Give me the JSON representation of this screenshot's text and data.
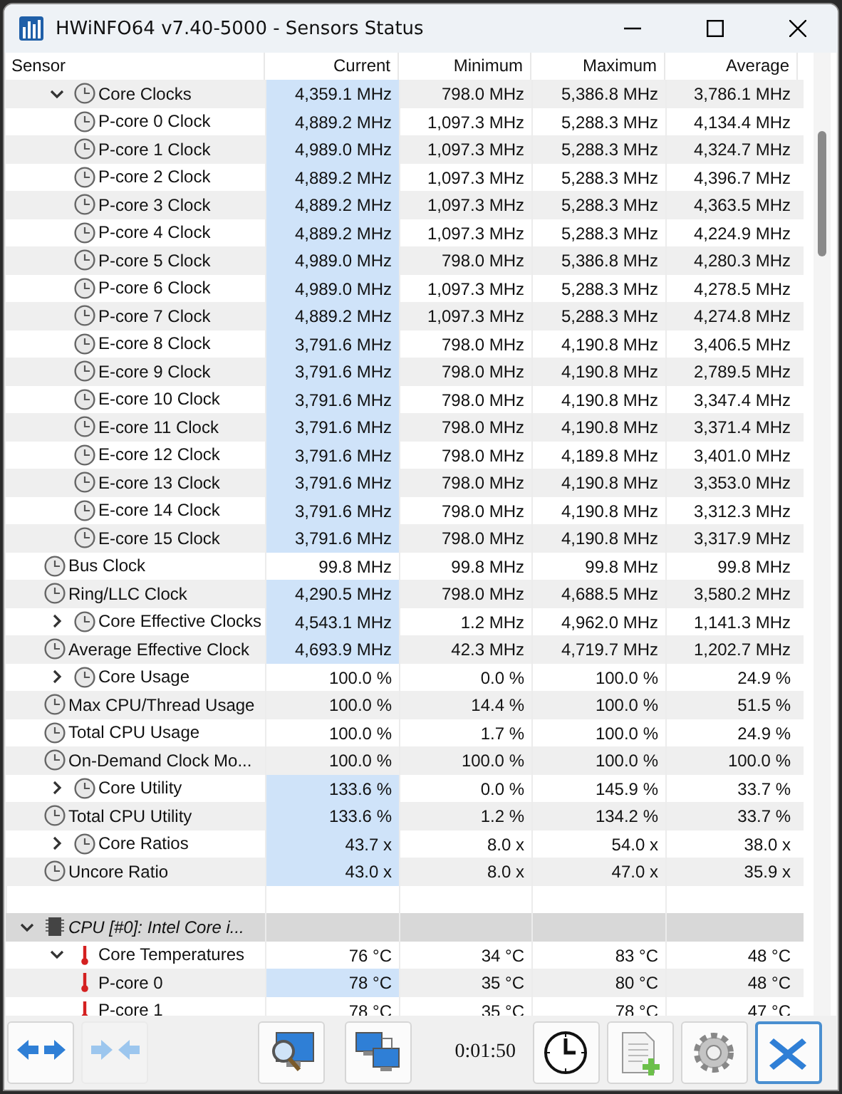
{
  "window": {
    "title": "HWiNFO64 v7.40-5000 - Sensors Status"
  },
  "columns": [
    "Sensor",
    "Current",
    "Minimum",
    "Maximum",
    "Average"
  ],
  "rows": [
    {
      "kind": "clock",
      "label": "Core Clocks",
      "current": "4,359.1 MHz",
      "minimum": "798.0 MHz",
      "maximum": "5,386.8 MHz",
      "average": "3,786.1 MHz",
      "highlighted": true,
      "expanded": true,
      "children": [
        {
          "kind": "clock",
          "label": "P-core 0 Clock",
          "current": "4,889.2 MHz",
          "minimum": "1,097.3 MHz",
          "maximum": "5,288.3 MHz",
          "average": "4,134.4 MHz",
          "highlighted": true
        },
        {
          "kind": "clock",
          "label": "P-core 1 Clock",
          "current": "4,989.0 MHz",
          "minimum": "1,097.3 MHz",
          "maximum": "5,288.3 MHz",
          "average": "4,324.7 MHz",
          "highlighted": true
        },
        {
          "kind": "clock",
          "label": "P-core 2 Clock",
          "current": "4,889.2 MHz",
          "minimum": "1,097.3 MHz",
          "maximum": "5,288.3 MHz",
          "average": "4,396.7 MHz",
          "highlighted": true
        },
        {
          "kind": "clock",
          "label": "P-core 3 Clock",
          "current": "4,889.2 MHz",
          "minimum": "1,097.3 MHz",
          "maximum": "5,288.3 MHz",
          "average": "4,363.5 MHz",
          "highlighted": true
        },
        {
          "kind": "clock",
          "label": "P-core 4 Clock",
          "current": "4,889.2 MHz",
          "minimum": "1,097.3 MHz",
          "maximum": "5,288.3 MHz",
          "average": "4,224.9 MHz",
          "highlighted": true
        },
        {
          "kind": "clock",
          "label": "P-core 5 Clock",
          "current": "4,989.0 MHz",
          "minimum": "798.0 MHz",
          "maximum": "5,386.8 MHz",
          "average": "4,280.3 MHz",
          "highlighted": true
        },
        {
          "kind": "clock",
          "label": "P-core 6 Clock",
          "current": "4,989.0 MHz",
          "minimum": "1,097.3 MHz",
          "maximum": "5,288.3 MHz",
          "average": "4,278.5 MHz",
          "highlighted": true
        },
        {
          "kind": "clock",
          "label": "P-core 7 Clock",
          "current": "4,889.2 MHz",
          "minimum": "1,097.3 MHz",
          "maximum": "5,288.3 MHz",
          "average": "4,274.8 MHz",
          "highlighted": true
        },
        {
          "kind": "clock",
          "label": "E-core 8 Clock",
          "current": "3,791.6 MHz",
          "minimum": "798.0 MHz",
          "maximum": "4,190.8 MHz",
          "average": "3,406.5 MHz",
          "highlighted": true
        },
        {
          "kind": "clock",
          "label": "E-core 9 Clock",
          "current": "3,791.6 MHz",
          "minimum": "798.0 MHz",
          "maximum": "4,190.8 MHz",
          "average": "2,789.5 MHz",
          "highlighted": true
        },
        {
          "kind": "clock",
          "label": "E-core 10 Clock",
          "current": "3,791.6 MHz",
          "minimum": "798.0 MHz",
          "maximum": "4,190.8 MHz",
          "average": "3,347.4 MHz",
          "highlighted": true
        },
        {
          "kind": "clock",
          "label": "E-core 11 Clock",
          "current": "3,791.6 MHz",
          "minimum": "798.0 MHz",
          "maximum": "4,190.8 MHz",
          "average": "3,371.4 MHz",
          "highlighted": true
        },
        {
          "kind": "clock",
          "label": "E-core 12 Clock",
          "current": "3,791.6 MHz",
          "minimum": "798.0 MHz",
          "maximum": "4,189.8 MHz",
          "average": "3,401.0 MHz",
          "highlighted": true
        },
        {
          "kind": "clock",
          "label": "E-core 13 Clock",
          "current": "3,791.6 MHz",
          "minimum": "798.0 MHz",
          "maximum": "4,190.8 MHz",
          "average": "3,353.0 MHz",
          "highlighted": true
        },
        {
          "kind": "clock",
          "label": "E-core 14 Clock",
          "current": "3,791.6 MHz",
          "minimum": "798.0 MHz",
          "maximum": "4,190.8 MHz",
          "average": "3,312.3 MHz",
          "highlighted": true
        },
        {
          "kind": "clock",
          "label": "E-core 15 Clock",
          "current": "3,791.6 MHz",
          "minimum": "798.0 MHz",
          "maximum": "4,190.8 MHz",
          "average": "3,317.9 MHz",
          "highlighted": true
        }
      ]
    },
    {
      "kind": "clock",
      "label": "Bus Clock",
      "current": "99.8 MHz",
      "minimum": "99.8 MHz",
      "maximum": "99.8 MHz",
      "average": "99.8 MHz",
      "highlighted": false
    },
    {
      "kind": "clock",
      "label": "Ring/LLC Clock",
      "current": "4,290.5 MHz",
      "minimum": "798.0 MHz",
      "maximum": "4,688.5 MHz",
      "average": "3,580.2 MHz",
      "highlighted": true
    },
    {
      "kind": "clock",
      "label": "Core Effective Clocks",
      "current": "4,543.1 MHz",
      "minimum": "1.2 MHz",
      "maximum": "4,962.0 MHz",
      "average": "1,141.3 MHz",
      "highlighted": true,
      "expanded": false
    },
    {
      "kind": "clock",
      "label": "Average Effective Clock",
      "current": "4,693.9 MHz",
      "minimum": "42.3 MHz",
      "maximum": "4,719.7 MHz",
      "average": "1,202.7 MHz",
      "highlighted": true
    },
    {
      "kind": "clock",
      "label": "Core Usage",
      "current": "100.0 %",
      "minimum": "0.0 %",
      "maximum": "100.0 %",
      "average": "24.9 %",
      "highlighted": false,
      "expanded": false
    },
    {
      "kind": "clock",
      "label": "Max CPU/Thread Usage",
      "current": "100.0 %",
      "minimum": "14.4 %",
      "maximum": "100.0 %",
      "average": "51.5 %",
      "highlighted": false
    },
    {
      "kind": "clock",
      "label": "Total CPU Usage",
      "current": "100.0 %",
      "minimum": "1.7 %",
      "maximum": "100.0 %",
      "average": "24.9 %",
      "highlighted": false
    },
    {
      "kind": "clock",
      "label": "On-Demand Clock Mo...",
      "current": "100.0 %",
      "minimum": "100.0 %",
      "maximum": "100.0 %",
      "average": "100.0 %",
      "highlighted": false
    },
    {
      "kind": "clock",
      "label": "Core Utility",
      "current": "133.6 %",
      "minimum": "0.0 %",
      "maximum": "145.9 %",
      "average": "33.7 %",
      "highlighted": true,
      "expanded": false
    },
    {
      "kind": "clock",
      "label": "Total CPU Utility",
      "current": "133.6 %",
      "minimum": "1.2 %",
      "maximum": "134.2 %",
      "average": "33.7 %",
      "highlighted": true
    },
    {
      "kind": "clock",
      "label": "Core Ratios",
      "current": "43.7 x",
      "minimum": "8.0 x",
      "maximum": "54.0 x",
      "average": "38.0 x",
      "highlighted": true,
      "expanded": false
    },
    {
      "kind": "clock",
      "label": "Uncore Ratio",
      "current": "43.0 x",
      "minimum": "8.0 x",
      "maximum": "47.0 x",
      "average": "35.9 x",
      "highlighted": true
    },
    {
      "kind": "blank"
    },
    {
      "kind": "section",
      "label": "CPU [#0]: Intel Core i...",
      "expanded": true,
      "children": [
        {
          "kind": "thermometer",
          "label": "Core Temperatures",
          "current": "76 °C",
          "minimum": "34 °C",
          "maximum": "83 °C",
          "average": "48 °C",
          "highlighted": false,
          "expanded": true,
          "children": [
            {
              "kind": "thermometer",
              "label": "P-core 0",
              "current": "78 °C",
              "minimum": "35 °C",
              "maximum": "80 °C",
              "average": "48 °C",
              "highlighted": true
            },
            {
              "kind": "thermometer",
              "label": "P-core 1",
              "current": "78 °C",
              "minimum": "35 °C",
              "maximum": "78 °C",
              "average": "47 °C",
              "highlighted": false
            }
          ]
        }
      ]
    }
  ],
  "toolbar": {
    "left": [
      {
        "kind": "expand",
        "disabled": false,
        "focused": false
      },
      {
        "kind": "collapse",
        "disabled": true,
        "focused": false
      }
    ],
    "right": [
      {
        "kind": "monitor-search",
        "disabled": false,
        "focused": false
      },
      {
        "kind": "network",
        "disabled": false,
        "focused": false
      }
    ],
    "timer": "0:01:50",
    "end": [
      {
        "kind": "clock",
        "disabled": false,
        "focused": false
      },
      {
        "kind": "report",
        "disabled": false,
        "focused": false
      },
      {
        "kind": "settings",
        "disabled": false,
        "focused": false
      },
      {
        "kind": "close",
        "disabled": false,
        "focused": true
      }
    ]
  }
}
